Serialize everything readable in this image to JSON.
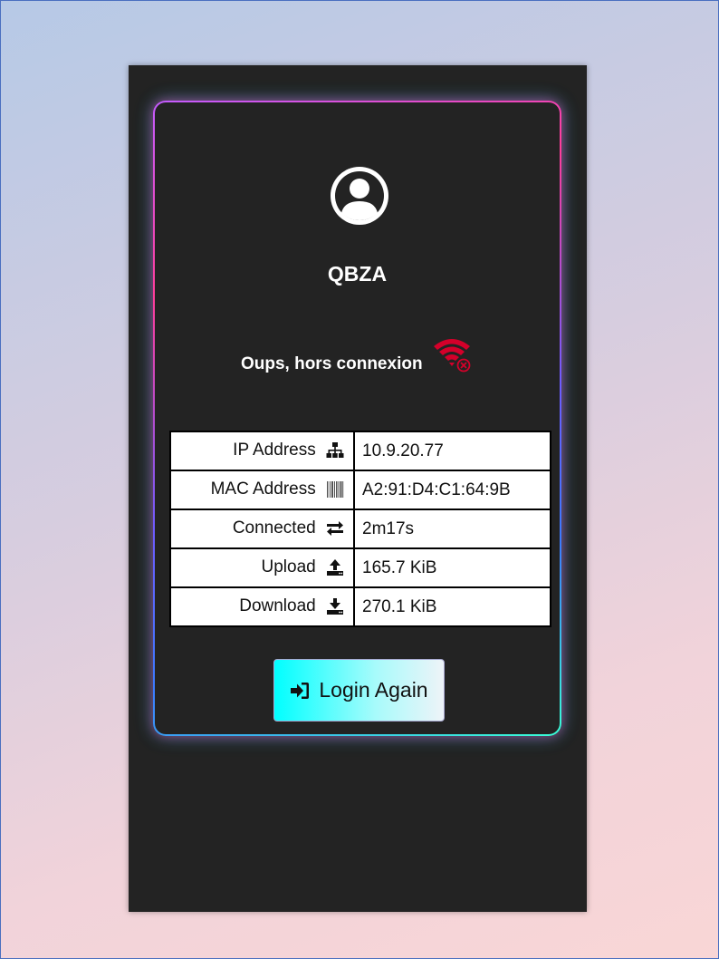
{
  "user": {
    "name": "QBZA",
    "avatar_icon": "user-circle-icon"
  },
  "status": {
    "message": "Oups, hors connexion",
    "icon": "wifi-off-icon",
    "icon_color": "#d4002a"
  },
  "info_table": {
    "rows": [
      {
        "label": "IP Address",
        "icon": "sitemap-icon",
        "value": "10.9.20.77"
      },
      {
        "label": "MAC Address",
        "icon": "barcode-icon",
        "value": "A2:91:D4:C1:64:9B"
      },
      {
        "label": "Connected",
        "icon": "exchange-icon",
        "value": "2m17s"
      },
      {
        "label": "Upload",
        "icon": "upload-icon",
        "value": "165.7 KiB"
      },
      {
        "label": "Download",
        "icon": "download-icon",
        "value": "270.1 KiB"
      }
    ]
  },
  "actions": {
    "login_label": "Login Again",
    "login_icon": "sign-in-icon"
  },
  "colors": {
    "panel_bg": "#232323",
    "button_gradient_start": "#00ffff",
    "button_gradient_end": "#eef3f8"
  }
}
